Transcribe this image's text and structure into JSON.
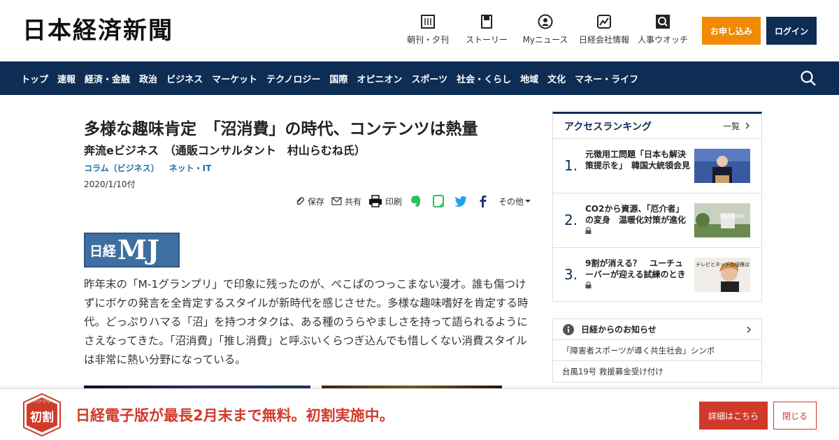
{
  "header": {
    "logo": "日本経済新聞",
    "nav": [
      {
        "label": "朝刊・夕刊",
        "icon": "newspaper-icon"
      },
      {
        "label": "ストーリー",
        "icon": "bookmark-icon"
      },
      {
        "label": "Myニュース",
        "icon": "user-icon"
      },
      {
        "label": "日経会社情報",
        "icon": "chart-icon"
      },
      {
        "label": "人事ウオッチ",
        "icon": "search-icon"
      }
    ],
    "subscribe_label": "お申し込み",
    "login_label": "ログイン"
  },
  "navbar": {
    "items": [
      "トップ",
      "速報",
      "経済・金融",
      "政治",
      "ビジネス",
      "マーケット",
      "テクノロジー",
      "国際",
      "オピニオン",
      "スポーツ",
      "社会・くらし",
      "地域",
      "文化",
      "マネー・ライフ"
    ]
  },
  "article": {
    "title": "多様な趣味肯定　「沼消費」の時代、コンテンツは熱量",
    "subtitle": "奔流eビジネス　（通販コンサルタント　村山らむね氏）",
    "tags": [
      "コラム（ビジネス）",
      "ネット・IT"
    ],
    "date": "2020/1/10付",
    "tools": {
      "save": "保存",
      "share": "共有",
      "print": "印刷",
      "more": "その他"
    },
    "brand_nikkei": "日経",
    "brand_mj": "MJ",
    "body": "昨年末の「M-1グランプリ」で印象に残ったのが、ぺこぱのつっこまない漫才。誰も傷つけずにボケの発言を全肯定するスタイルが新時代を感じさせた。多様な趣味嗜好を肯定する時代。どっぷりハマる「沼」を持つオタクは、ある種のうらやましさを持って語られるようにさえなってきた。「沼消費」「推し消費」と呼ぶいくらつぎ込んでも惜しくない消費スタイルは非常に熱い分野になっている。"
  },
  "ranking": {
    "title": "アクセスランキング",
    "more": "一覧",
    "items": [
      {
        "num": "1.",
        "text": "元徴用工問題「日本も解決策提示を」　韓国大統領会見",
        "locked": false
      },
      {
        "num": "2.",
        "text": "CO2から資源、「厄介者」の変身　温暖化対策が進化",
        "locked": true,
        "img_caption": "Disruption"
      },
      {
        "num": "3.",
        "text": "9割が消える？　ユーチューバーが迎える試練のとき",
        "locked": true,
        "img_caption": "テレビとネットの垣根はない"
      }
    ]
  },
  "notices": {
    "title": "日経からのお知らせ",
    "items": [
      "「障害者スポーツが導く共生社会」シンポ",
      "台風19号 救援募金受け付け"
    ]
  },
  "banner": {
    "badge_text": "初割",
    "badge_ruby": "ハツワリ",
    "text": "日経電子版が最長2月末まで無料。初割実施中。",
    "detail_label": "詳細はこちら",
    "close_label": "閉じる"
  },
  "colors": {
    "navy": "#0d2d54",
    "orange": "#f08a00",
    "red": "#cf3a2b",
    "link": "#1e6fa8"
  }
}
